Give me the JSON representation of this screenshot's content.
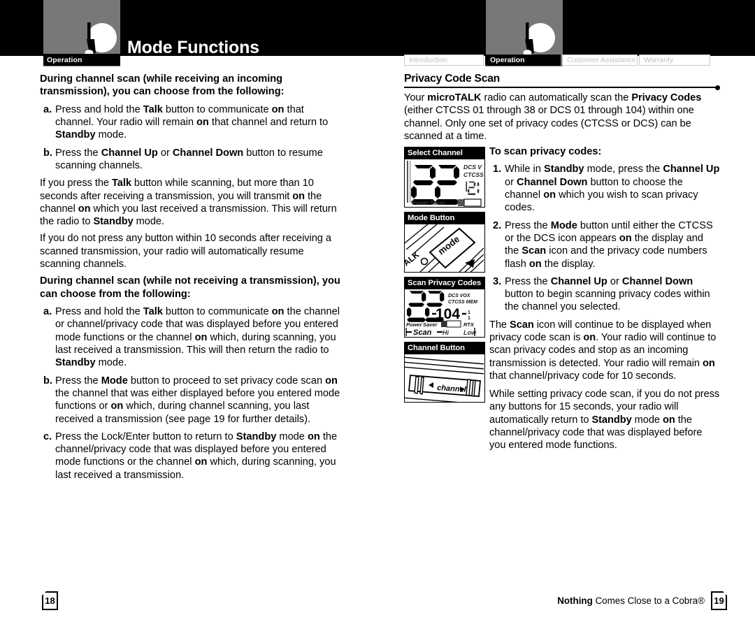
{
  "header": {
    "page_title": "Mode Functions",
    "left_section_label": "Operation",
    "logo_icon": "cobra-radio-icon",
    "tabs": [
      {
        "label": "Introduction",
        "active": false
      },
      {
        "label": "Operation",
        "active": true
      },
      {
        "label": "Customer Assistance",
        "active": false
      },
      {
        "label": "Warranty",
        "active": false
      }
    ]
  },
  "left_page": {
    "blocks": [
      {
        "type": "heading",
        "text": "During channel scan (while receiving an incoming transmission), you can choose from the following:"
      },
      {
        "type": "list-item",
        "mark": "a.",
        "text": "Press and hold the Talk button to communicate on that channel. Your radio will remain on that channel and return to Standby mode."
      },
      {
        "type": "list-item",
        "mark": "b.",
        "text": "Press the Channel Up or Channel Down button to resume scanning channels."
      },
      {
        "type": "paragraph",
        "text": "If you press the Talk button while scanning, but more than 10 seconds after receiving a transmission, you will transmit on the channel on which you last received a transmission. This will return the radio to Standby mode."
      },
      {
        "type": "paragraph",
        "text": "If you do not press any button within 10 seconds after receiving a scanned transmission, your radio will automatically resume scanning channels."
      },
      {
        "type": "heading",
        "text": "During channel scan (while not receiving a transmission), you can choose from the following:"
      },
      {
        "type": "list-item",
        "mark": "a.",
        "text": "Press and hold the Talk button to communicate on the channel or channel/privacy code that was displayed before you entered mode functions or the channel on which, during scanning, you last received a transmission. This will then return the radio to Standby mode."
      },
      {
        "type": "list-item",
        "mark": "b.",
        "text": "Press the Mode button to proceed to set privacy code scan on the channel that was either displayed before you entered mode functions or on which, during channel scanning, you last received a transmission (see page 19 for further details)."
      },
      {
        "type": "list-item",
        "mark": "c.",
        "text": "Press the Lock/Enter button to return to Standby mode on the channel/privacy code that was displayed before you entered mode functions or the channel on which, during scanning, you last received a transmission."
      }
    ]
  },
  "right_page": {
    "section_title": "Privacy Code Scan",
    "intro": "Your microTALK radio can automatically scan the Privacy Codes (either CTCSS 01 through 38 or DCS 01 through 104) within one channel. Only one set of privacy codes (CTCSS or DCS) can be scanned at a time.",
    "sub_heading": "To scan privacy codes:",
    "steps": [
      {
        "mark": "1.",
        "text": "While in Standby mode, press the Channel Up or Channel Down button to choose the channel on which you wish to scan privacy codes."
      },
      {
        "mark": "2.",
        "text": "Press the Mode button until either the CTCSS or the DCS icon appears on the display and the Scan icon and the privacy code numbers flash on the display."
      },
      {
        "mark": "3.",
        "text": "Press the Channel Up or Channel Down button to begin scanning privacy codes within the channel you selected."
      }
    ],
    "after_paragraphs": [
      "The Scan icon will continue to be displayed when privacy code scan is on. Your radio will continue to scan privacy codes and stop as an incoming transmission is detected. Your radio will remain on that channel/privacy code for 10 seconds.",
      "While setting privacy code scan, if you do not press any buttons for 15 seconds, your radio will automatically return to Standby mode on the channel/privacy code that was displayed before you entered mode functions."
    ],
    "figures": [
      {
        "caption": "Select Channel",
        "icon": "lcd-display-icon",
        "lcd": {
          "channel": "22",
          "code": "04",
          "indicators": [
            "DCS VOX",
            "CTCSS",
            "Power Saver"
          ]
        }
      },
      {
        "caption": "Mode Button",
        "icon": "mode-button-icon",
        "button_text": "mode",
        "side_text": "ALK"
      },
      {
        "caption": "Scan Privacy Codes",
        "icon": "lcd-display-scan-icon",
        "lcd": {
          "channel": "22",
          "code": "104",
          "indicators": [
            "DCS VOX",
            "CTCSS MEM",
            "Power Saver",
            "Scan",
            "Hi",
            "Low",
            "RTX"
          ]
        }
      },
      {
        "caption": "Channel Button",
        "icon": "channel-button-icon",
        "button_text": "channel"
      }
    ]
  },
  "footer": {
    "left_page_number": "18",
    "right_page_number": "19",
    "tagline_bold": "Nothing",
    "tagline_rest": " Comes Close to a Cobra®"
  },
  "colors": {
    "black": "#000000",
    "gray_tab": "#787878",
    "tab_inactive_text": "#c0c0c0",
    "tab_border": "#c9c9c9"
  }
}
